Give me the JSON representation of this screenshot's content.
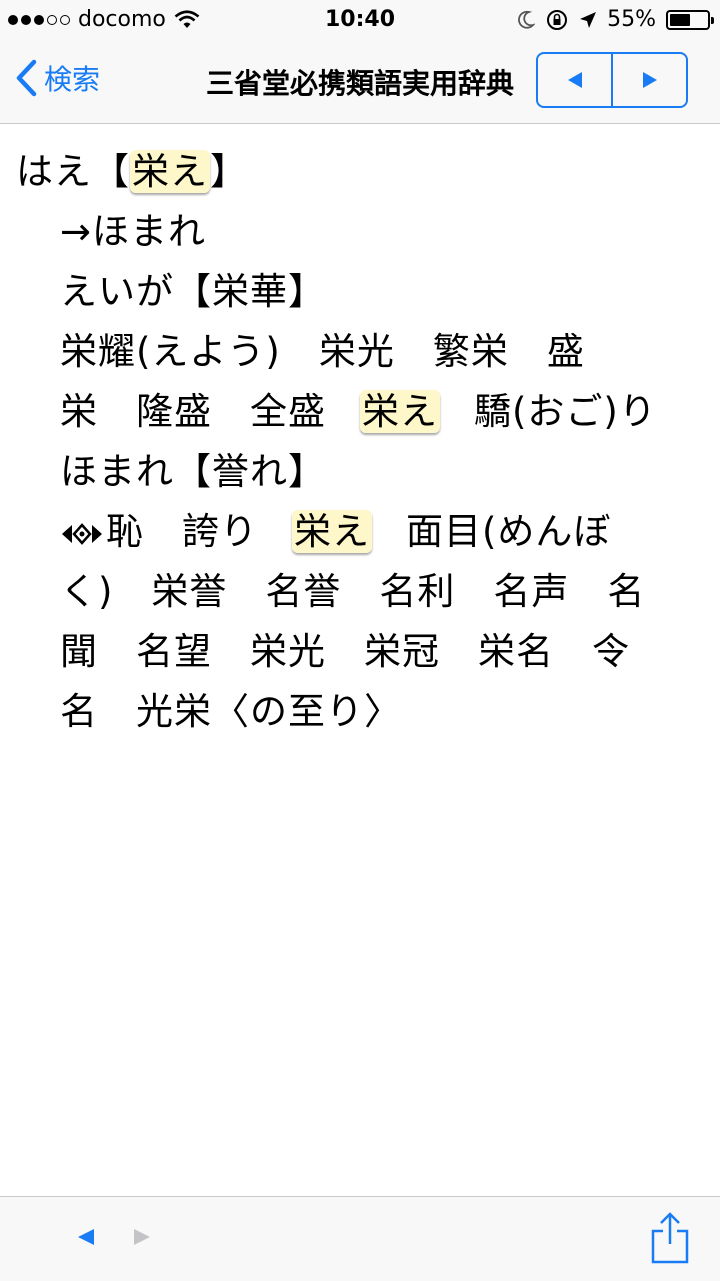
{
  "status_bar": {
    "carrier": "docomo",
    "time": "10:40",
    "battery_percent": "55%",
    "battery_level": 0.55,
    "signal_dots_filled": 3,
    "signal_dots_total": 5
  },
  "nav": {
    "back_label": "検索",
    "title": "三省堂必携類語実用辞典"
  },
  "colors": {
    "accent": "#1a7cf5",
    "highlight": "#fdf7c9"
  },
  "entry": {
    "line1_pre": "はえ【",
    "line1_hl": "栄え",
    "line1_post": "】",
    "line2": "→ほまれ",
    "line3": "えいが【栄華】",
    "line4": "栄耀(えよう)　栄光　繁栄　盛",
    "line5_pre": "栄　隆盛　全盛",
    "line5_hl": "栄え",
    "line5_post": "驕(おご)り",
    "line6": "ほまれ【誉れ】",
    "line7_mid": "恥　誇り",
    "line7_hl": "栄え",
    "line7_post": "面目(めんぼ",
    "line8": "く)　栄誉　名誉　名利　名声　名",
    "line9": "聞　名望　栄光　栄冠　栄名　令",
    "line10": "名　光栄〈の至り〉"
  }
}
